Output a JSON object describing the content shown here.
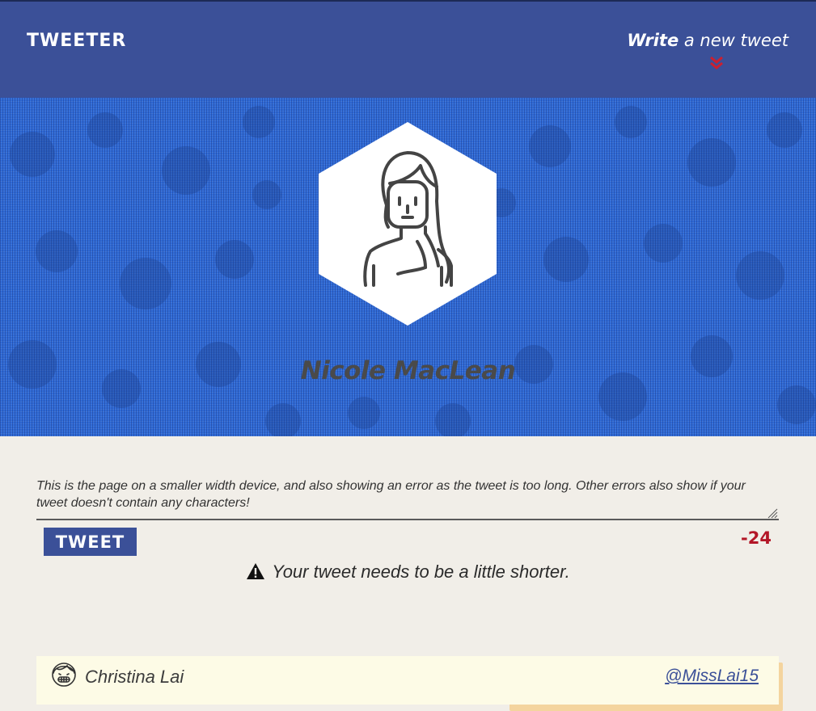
{
  "header": {
    "brand": "TWEETER",
    "compose_link_bold": "Write",
    "compose_link_rest": " a new tweet",
    "chevron_icon": "double-chevron-down-icon",
    "chevron_color": "#cc1f2f",
    "background": "#3b5098"
  },
  "profile": {
    "name": "Nicole MacLean",
    "avatar_icon": "woman-avatar-icon",
    "hero_color": "#2f6ad6"
  },
  "composer": {
    "value": "This is the page on a smaller width device, and also showing an error as the tweet is too long. Other errors also show if your tweet doesn't contain any characters!",
    "tweet_button_label": "TWEET",
    "char_counter": "-24",
    "counter_color": "#b31627"
  },
  "error": {
    "icon": "warning-icon",
    "message": "Your tweet needs to be a little shorter."
  },
  "tweets": [
    {
      "avatar_icon": "grinning-girl-avatar-icon",
      "author": "Christina Lai",
      "handle": "@MissLai15"
    }
  ]
}
